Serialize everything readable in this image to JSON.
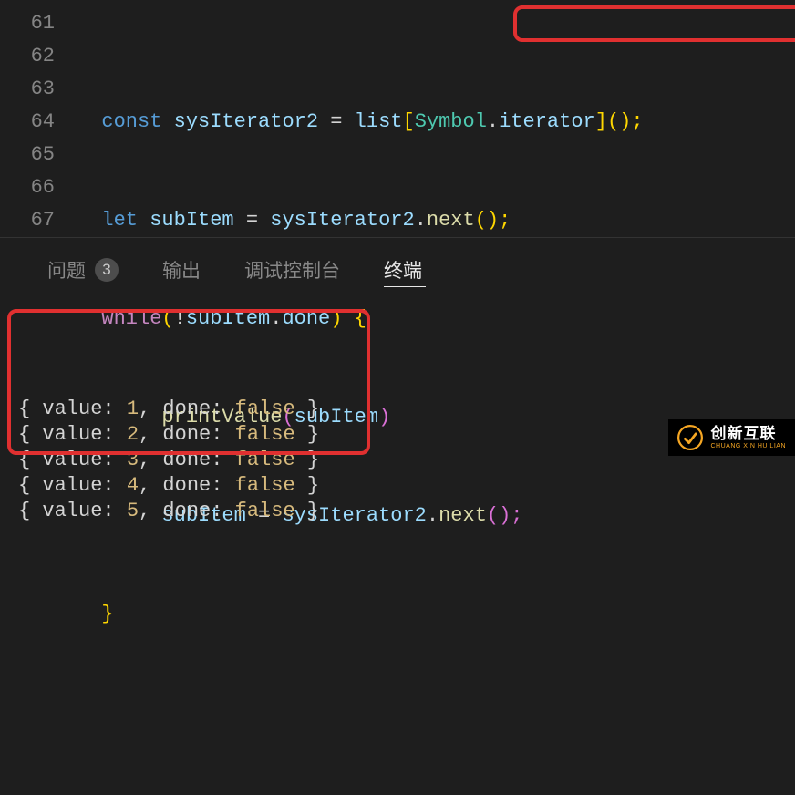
{
  "gutter": [
    "61",
    "62",
    "63",
    "64",
    "65",
    "66",
    "67"
  ],
  "code": {
    "l61": {
      "kw": "const",
      "var": "sysIterator2",
      "eq": " = ",
      "obj": "list",
      "lb": "[",
      "sym": "Symbol",
      "dot": ".",
      "iter": "iterator",
      "rb": "]",
      "call": "();"
    },
    "l62": {
      "kw": "let",
      "var": "subItem",
      "eq": " = ",
      "it": "sysIterator2",
      "dot": ".",
      "fn": "next",
      "call": "();"
    },
    "l63": {
      "kw": "while",
      "lp": "(",
      "neg": "!",
      "obj": "subItem",
      "dot": ".",
      "prop": "done",
      "rp": ")",
      "sp": " ",
      "lb": "{"
    },
    "l64": {
      "fn": "printValue",
      "lp": "(",
      "arg": "subItem",
      "rp": ")"
    },
    "l65": {
      "var": "subItem",
      "eq": " = ",
      "it": "sysIterator2",
      "dot": ".",
      "fn": "next",
      "call": "();"
    },
    "l66": {
      "rb": "}"
    }
  },
  "tabs": {
    "problems": "问题",
    "problems_count": "3",
    "output": "输出",
    "debug": "调试控制台",
    "terminal": "终端"
  },
  "terminal_lines": [
    {
      "v": "1",
      "d": "false"
    },
    {
      "v": "2",
      "d": "false"
    },
    {
      "v": "3",
      "d": "false"
    },
    {
      "v": "4",
      "d": "false"
    },
    {
      "v": "5",
      "d": "false"
    }
  ],
  "terminal_template": {
    "open": "{ ",
    "kval": "value: ",
    "sep": ", ",
    "kdone": "done: ",
    "close": " }"
  },
  "watermark": {
    "main": "创新互联",
    "sub": "CHUANG XIN HU LIAN"
  }
}
